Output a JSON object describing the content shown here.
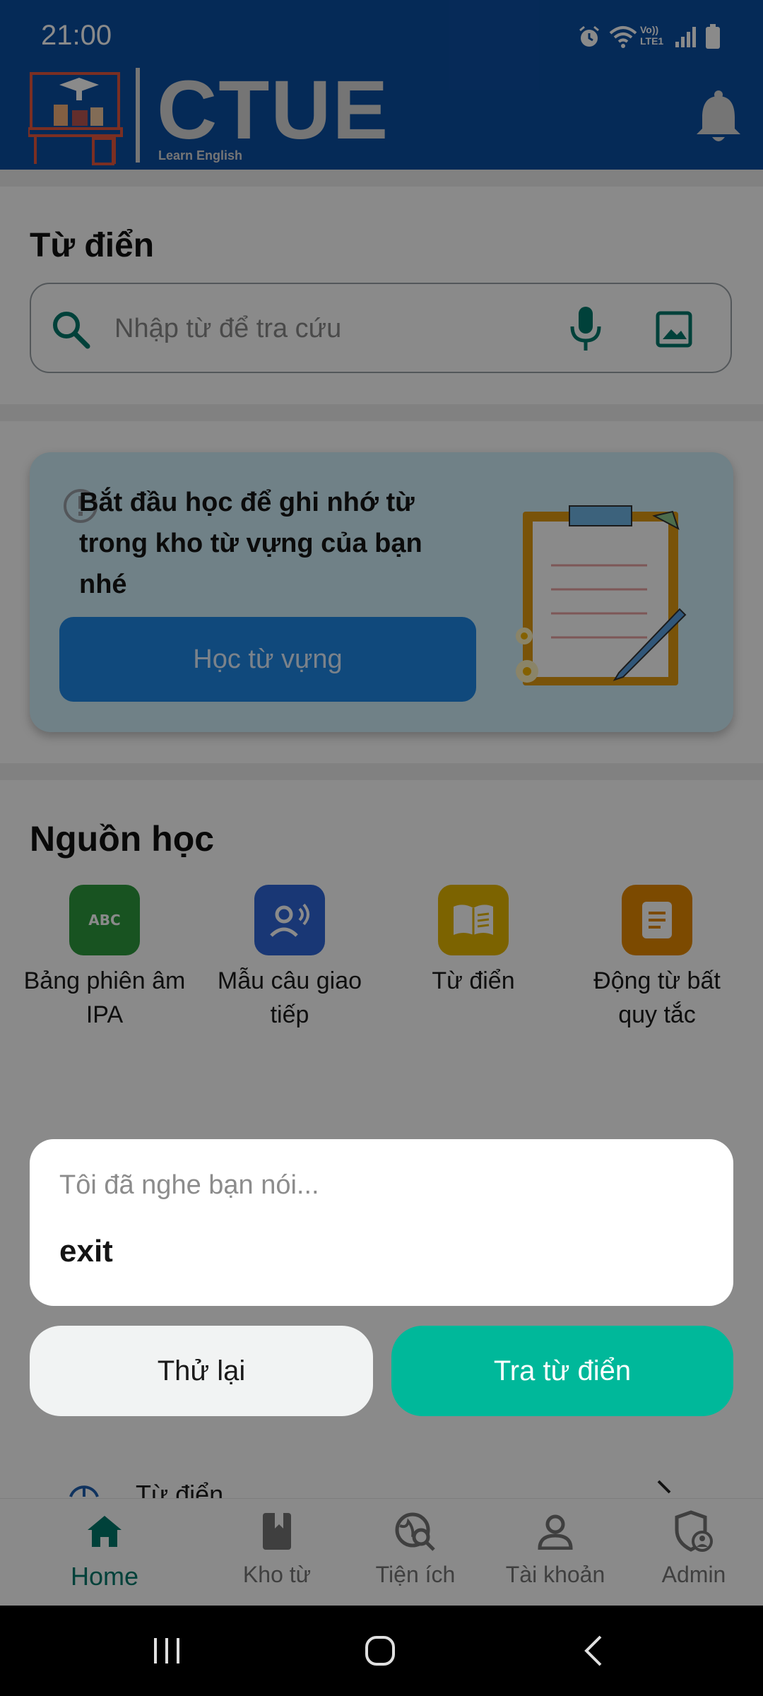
{
  "status_bar": {
    "time": "21:00",
    "network_label": "Vo)) LTE1"
  },
  "header": {
    "brand": "CTUE",
    "brand_sub": "Learn English"
  },
  "dictionary": {
    "title": "Từ điển",
    "search_placeholder": "Nhập từ để tra cứu"
  },
  "promo": {
    "message": "Bắt đầu học để ghi nhớ từ trong kho từ vựng của bạn nhé",
    "button_label": "Học từ vựng"
  },
  "resources": {
    "title": "Nguồn học",
    "items": [
      {
        "label": "Bảng phiên âm IPA",
        "icon": "abc-icon",
        "color": "#2e9a3e"
      },
      {
        "label": "Mẫu câu giao tiếp",
        "icon": "speaking-person-icon",
        "color": "#2f66d8"
      },
      {
        "label": "Từ điển",
        "icon": "book-icon",
        "color": "#e6b800"
      },
      {
        "label": "Động từ bất quy tắc",
        "icon": "document-icon",
        "color": "#e58a00"
      }
    ]
  },
  "below_list": {
    "item_partial": "Từ điển"
  },
  "bottom_nav": {
    "items": [
      {
        "label": "Home",
        "icon": "home-icon",
        "active": true
      },
      {
        "label": "Kho từ",
        "icon": "bookmark-book-icon",
        "active": false
      },
      {
        "label": "Tiện ích",
        "icon": "globe-search-icon",
        "active": false
      },
      {
        "label": "Tài khoản",
        "icon": "person-icon",
        "active": false
      },
      {
        "label": "Admin",
        "icon": "admin-shield-icon",
        "active": false
      }
    ]
  },
  "dialog": {
    "hint": "Tôi đã nghe bạn nói...",
    "recognized_text": "exit",
    "retry_label": "Thử lại",
    "lookup_label": "Tra từ điển"
  },
  "colors": {
    "header_bg": "#0b4ea2",
    "accent": "#00b89a",
    "nav_active": "#00796b",
    "nav_inactive": "#757575"
  }
}
